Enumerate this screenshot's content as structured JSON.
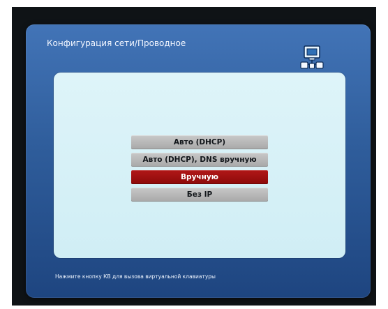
{
  "window": {
    "title": "Конфигурация сети/Проводное"
  },
  "menu": {
    "items": [
      {
        "label": "Авто (DHCP)",
        "selected": false
      },
      {
        "label": "Авто (DHCP), DNS вручную",
        "selected": false
      },
      {
        "label": "Вручную",
        "selected": true
      },
      {
        "label": "Без IP",
        "selected": false
      }
    ]
  },
  "footer": {
    "hint": "Нажмите кнопку КВ для вызова виртуальной клавиатуры"
  },
  "icons": {
    "network": "network-icon"
  },
  "colors": {
    "panel_top": "#4274b7",
    "panel_bottom": "#1e4580",
    "content_background": "#def4f9",
    "option_default": "#b8b8b8",
    "option_selected": "#9f1111"
  }
}
